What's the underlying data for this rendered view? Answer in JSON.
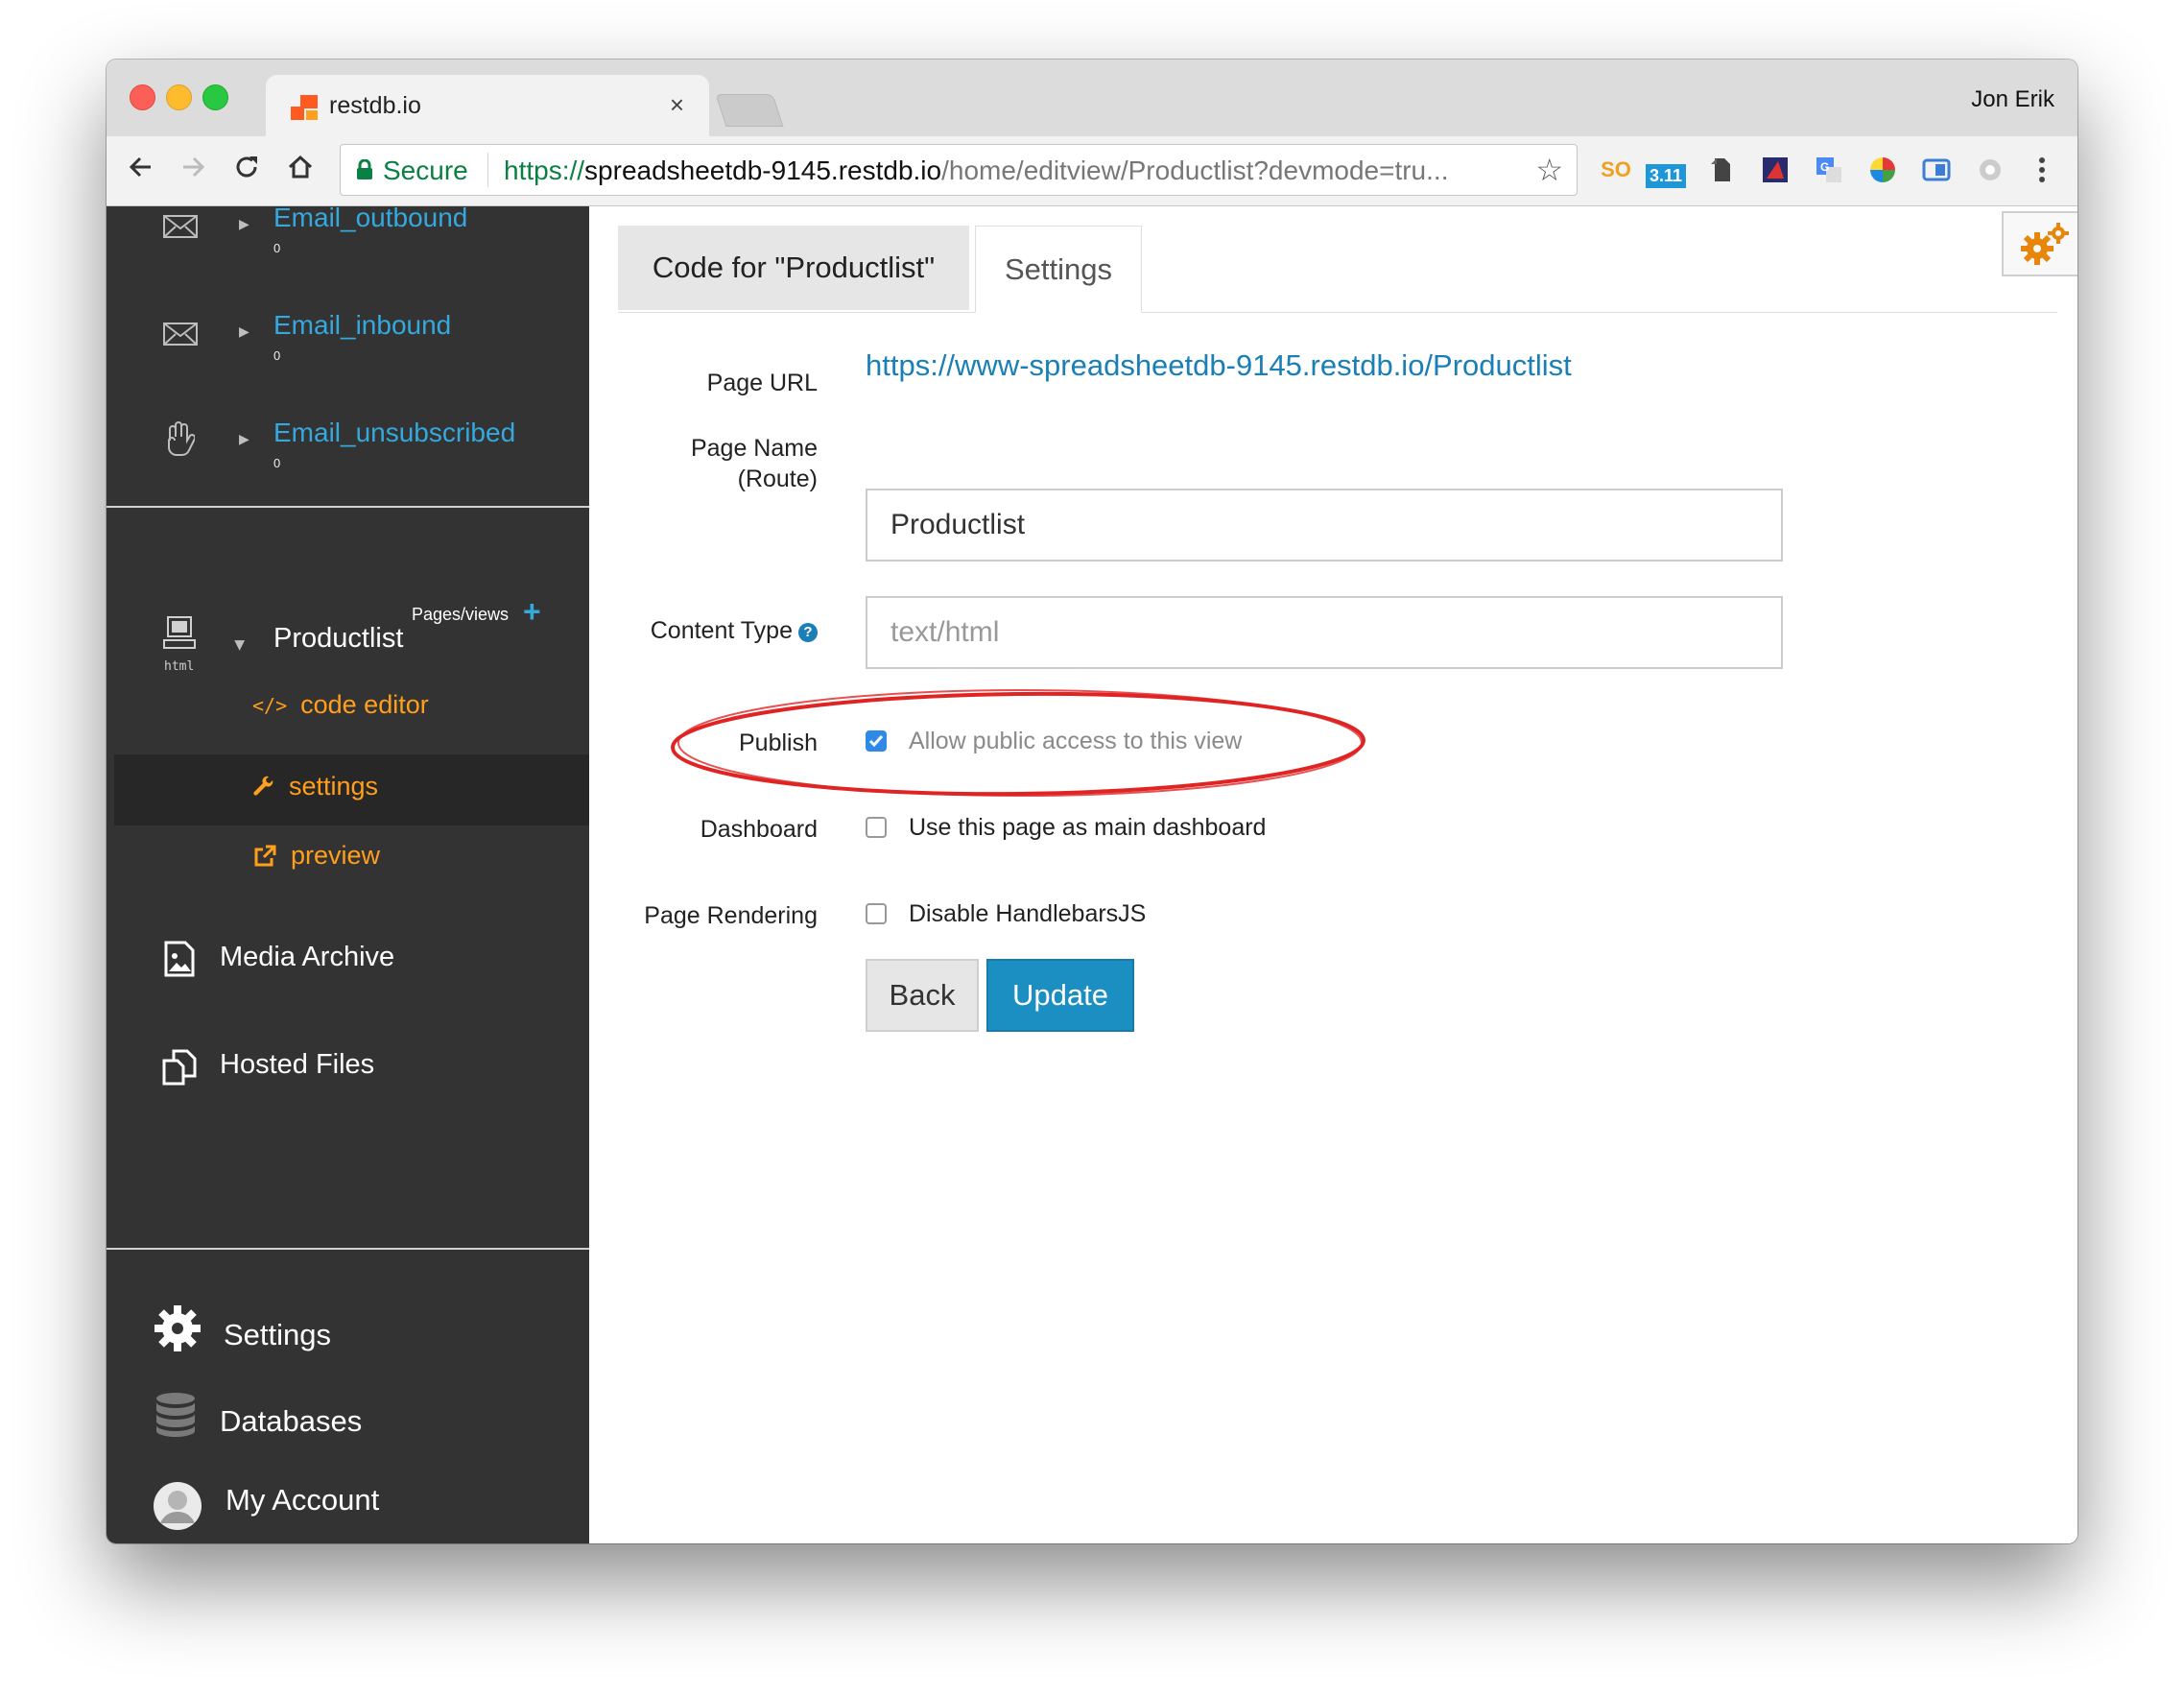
{
  "browser": {
    "tab_title": "restdb.io",
    "tab_close": "×",
    "profile_name": "Jon Erik",
    "secure_label": "Secure",
    "url_protocol": "https://",
    "url_host": "spreadsheetdb-9145.restdb.io",
    "url_path": "/home/editview/Productlist?devmode=tru...",
    "extension_badge": "3.11"
  },
  "sidebar": {
    "collections": [
      {
        "name": "Email_outbound",
        "count": "0",
        "icon": "envelope-icon"
      },
      {
        "name": "Email_inbound",
        "count": "0",
        "icon": "envelope-icon"
      },
      {
        "name": "Email_unsubscribed",
        "count": "0",
        "icon": "hand-icon"
      }
    ],
    "pages_header": "Pages/views",
    "page": {
      "name": "Productlist",
      "icon_caption": "html"
    },
    "page_links": {
      "code_editor": "code editor",
      "settings": "settings",
      "preview": "preview"
    },
    "media_archive": "Media Archive",
    "hosted_files": "Hosted Files",
    "bottom": {
      "settings": "Settings",
      "databases": "Databases",
      "my_account": "My Account"
    }
  },
  "main": {
    "tabs": [
      {
        "label": "Code for \"Productlist\"",
        "active": false
      },
      {
        "label": "Settings",
        "active": true
      }
    ],
    "form": {
      "page_url_label": "Page URL",
      "page_url_value": "https://www-spreadsheetdb-9145.restdb.io/Productlist",
      "page_name_label_line1": "Page Name",
      "page_name_label_line2": "(Route)",
      "page_name_value": "Productlist",
      "content_type_label": "Content Type",
      "content_type_placeholder": "text/html",
      "publish_label": "Publish",
      "publish_text": "Allow public access to this view",
      "publish_checked": true,
      "dashboard_label": "Dashboard",
      "dashboard_text": "Use this page as main dashboard",
      "dashboard_checked": false,
      "rendering_label": "Page Rendering",
      "rendering_text": "Disable HandlebarsJS",
      "rendering_checked": false
    },
    "buttons": {
      "back": "Back",
      "update": "Update"
    }
  },
  "colors": {
    "sidebar_bg": "#333333",
    "collection_link": "#35a8dd",
    "page_link": "#ff9f1c",
    "update_button": "#1b8ec2",
    "annotation": "#e02424"
  }
}
